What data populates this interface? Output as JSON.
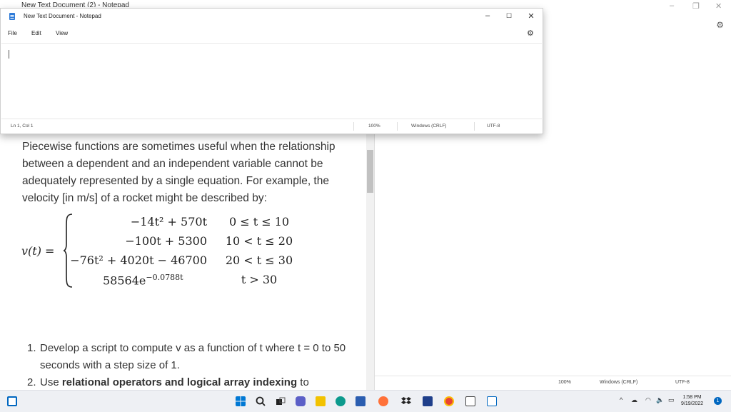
{
  "background_window": {
    "title": "New Text Document (2) - Notepad",
    "status": {
      "zoom": "100%",
      "line_ending": "Windows (CRLF)",
      "encoding": "UTF-8"
    }
  },
  "notepad": {
    "title": "New Text Document - Notepad",
    "menu": {
      "file": "File",
      "edit": "Edit",
      "view": "View"
    },
    "controls": {
      "minimize": "–",
      "maximize": "☐",
      "close": "✕"
    },
    "status": {
      "position": "Ln 1, Col 1",
      "zoom": "100%",
      "line_ending": "Windows (CRLF)",
      "encoding": "UTF-8"
    },
    "content": ""
  },
  "document": {
    "paragraph": "Piecewise functions are sometimes useful when the relationship between a dependent and an independent variable cannot be adequately represented by a single equation.  For example, the velocity  [in m/s] of a rocket might be described by:",
    "equation": {
      "lhs": "v(t) =",
      "rows": [
        {
          "expr": "−14t² + 570t",
          "cond": "0 ≤ t ≤ 10"
        },
        {
          "expr": "−100t + 5300",
          "cond": "10 < t ≤ 20"
        },
        {
          "expr": "−76t² + 4020t − 46700",
          "cond": "20 < t ≤ 30"
        },
        {
          "expr": "58564e",
          "exp": "−0.0788t",
          "cond": "t > 30"
        }
      ]
    },
    "list": [
      {
        "num": "1.",
        "text": "Develop a script to compute v as a function of t where t = 0 to 50 seconds with a step size of 1."
      },
      {
        "num": "2.",
        "pre": "Use ",
        "bold": "relational operators and logical array indexing",
        "post": " to"
      }
    ]
  },
  "taskbar": {
    "time": "1:58 PM",
    "date": "9/19/2022",
    "notification_count": "1"
  },
  "colors": {
    "accent": "#0067c0",
    "taskbar": "#eef0f4"
  }
}
